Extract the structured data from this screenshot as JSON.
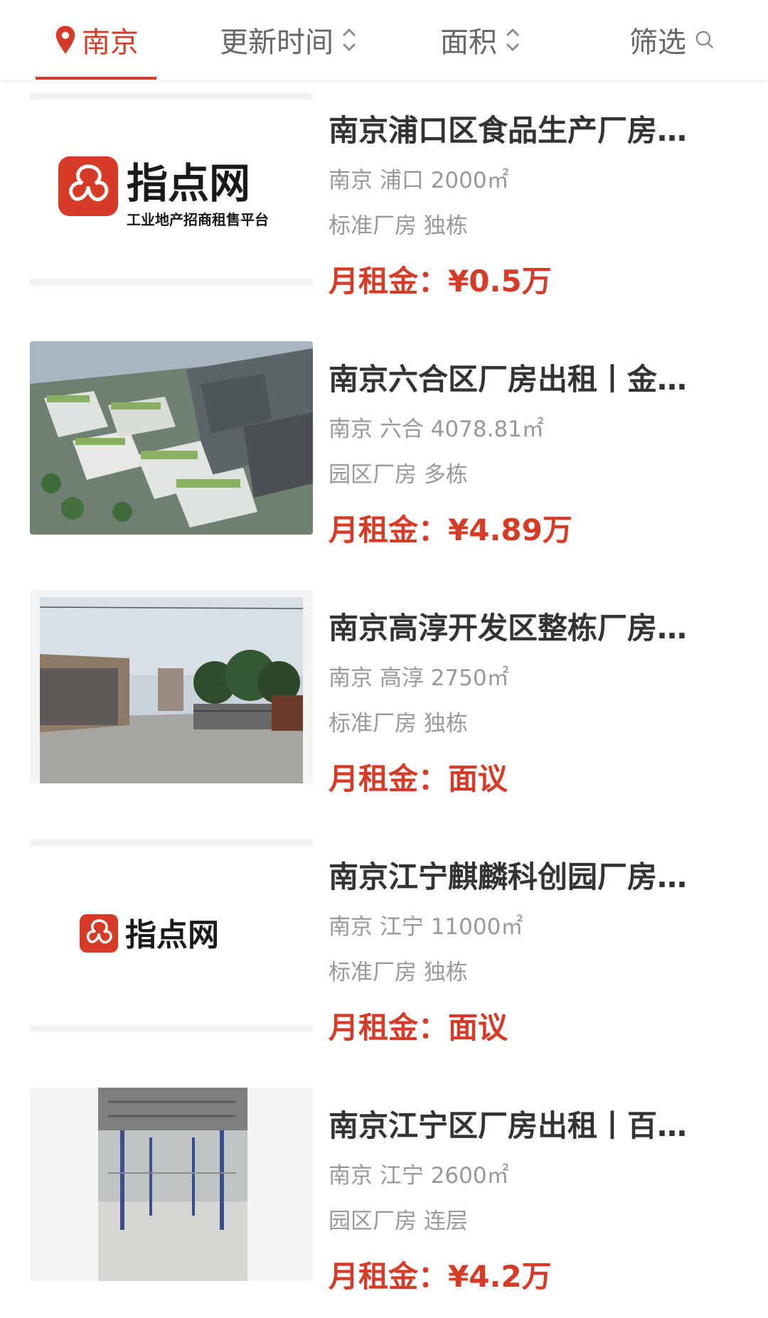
{
  "tabs": {
    "city": "南京",
    "update_time": "更新时间",
    "area": "面积",
    "filter": "筛选"
  },
  "brand": {
    "logo_text": "指点网",
    "logo_tagline": "工业地产招商租售平台"
  },
  "listings": [
    {
      "title": "南京浦口区食品生产厂房…",
      "location": "南京 浦口 2000㎡",
      "tags": "标准厂房 独栋",
      "price": "月租金：¥0.5万",
      "image": "logo-large"
    },
    {
      "title": "南京六合区厂房出租丨金…",
      "location": "南京 六合 4078.81㎡",
      "tags": "园区厂房 多栋",
      "price": "月租金：¥4.89万",
      "image": "aerial-park-render"
    },
    {
      "title": "南京高淳开发区整栋厂房…",
      "location": "南京 高淳 2750㎡",
      "tags": "标准厂房 独栋",
      "price": "月租金：面议",
      "image": "factory-gate-photo"
    },
    {
      "title": "南京江宁麒麟科创园厂房…",
      "location": "南京 江宁 11000㎡",
      "tags": "标准厂房 独栋",
      "price": "月租金：面议",
      "image": "logo-small"
    },
    {
      "title": "南京江宁区厂房出租丨百…",
      "location": "南京 江宁 2600㎡",
      "tags": "园区厂房 连层",
      "price": "月租金：¥4.2万",
      "image": "warehouse-interior-photo"
    }
  ],
  "colors": {
    "accent": "#d63b27",
    "title": "#333333",
    "meta": "#999999"
  }
}
